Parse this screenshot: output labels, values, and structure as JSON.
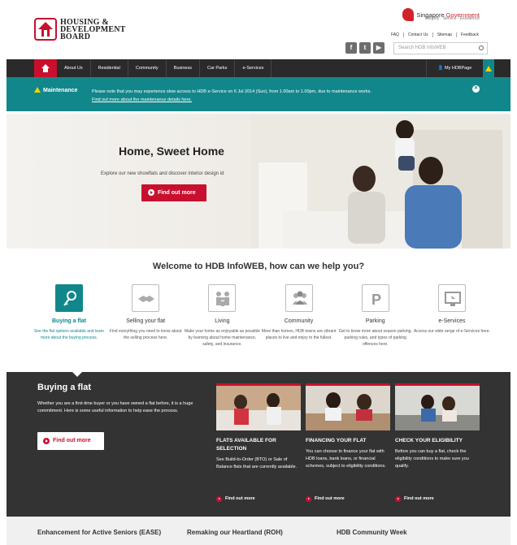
{
  "header": {
    "logo_line1": "HOUSING &",
    "logo_line2": "DEVELOPMENT",
    "logo_line3": "BOARD",
    "gov_prefix": "Singapore ",
    "gov_highlight": "Government",
    "gov_tagline": "Integrity · Service · Excellence",
    "utility_links": [
      "FAQ",
      "Contact Us",
      "Sitemap",
      "Feedback"
    ],
    "social_icons": [
      "facebook-icon",
      "twitter-icon",
      "youtube-icon"
    ],
    "search_placeholder": "Search HDB InfoWEB"
  },
  "nav": {
    "items": [
      "About Us",
      "Residential",
      "Community",
      "Business",
      "Car Parks",
      "e-Services"
    ],
    "my_hdb": "My HDBPage"
  },
  "maintenance": {
    "title": "Maintenance",
    "message": "Please note that you may experience slow access to HDB e-Service on 6 Jul 2014 (Sun), from 1.00am to 1.00pm, due to maintenance works.",
    "link": "Find out more about the maintenance details here."
  },
  "hero": {
    "title": "Home, Sweet Home",
    "subtitle": "Explore our new showflats and discover interior design id",
    "button": "Find out more"
  },
  "welcome": "Welcome to HDB InfoWEB, how can we help you?",
  "services": [
    {
      "title": "Buying a flat",
      "desc": "See the flat options available and learn more about the buying process."
    },
    {
      "title": "Selling your flat",
      "desc": "Find everything you need to know about the selling process here."
    },
    {
      "title": "Living",
      "desc": "Make your home as enjoyable as possible by learning about home maintenance, safety, and insurance."
    },
    {
      "title": "Community",
      "desc": "More than homes, HDB towns are vibrant places to live and enjoy to the fullest."
    },
    {
      "title": "Parking",
      "desc": "Get to know more about season parking, parking rules, and types of parking offences here."
    },
    {
      "title": "e-Services",
      "desc": "Access our wide range of e-Services here."
    }
  ],
  "band": {
    "title": "Buying a flat",
    "text": "Whether you are a first-time buyer or you have owned a flat before, it is a huge commitment. Here is some useful information to help ease the process.",
    "button": "Find out more",
    "cards": [
      {
        "title": "FLATS AVAILABLE FOR SELECTION",
        "desc": "See Build-to-Order (BTO) or Sale of Balance flats that are currently available.",
        "link": "Find out more"
      },
      {
        "title": "FINANCING YOUR FLAT",
        "desc": "You can choose to finance your flat with HDB loans, bank loans, or financial schemes, subject to eligibility conditions.",
        "link": "Find out more"
      },
      {
        "title": "CHECK YOUR ELIGIBILITY",
        "desc": "Before you can buy a flat, check the eligibility conditions to make sure you qualify.",
        "link": "Find out more"
      }
    ]
  },
  "bottom": [
    "Enhancement for Active Seniors (EASE)",
    "Remaking our Heartland (ROH)",
    "HDB Community Week"
  ],
  "colors": {
    "brand_red": "#c8102e",
    "teal": "#12878b",
    "dark": "#333333",
    "nav": "#2a2a2a"
  }
}
